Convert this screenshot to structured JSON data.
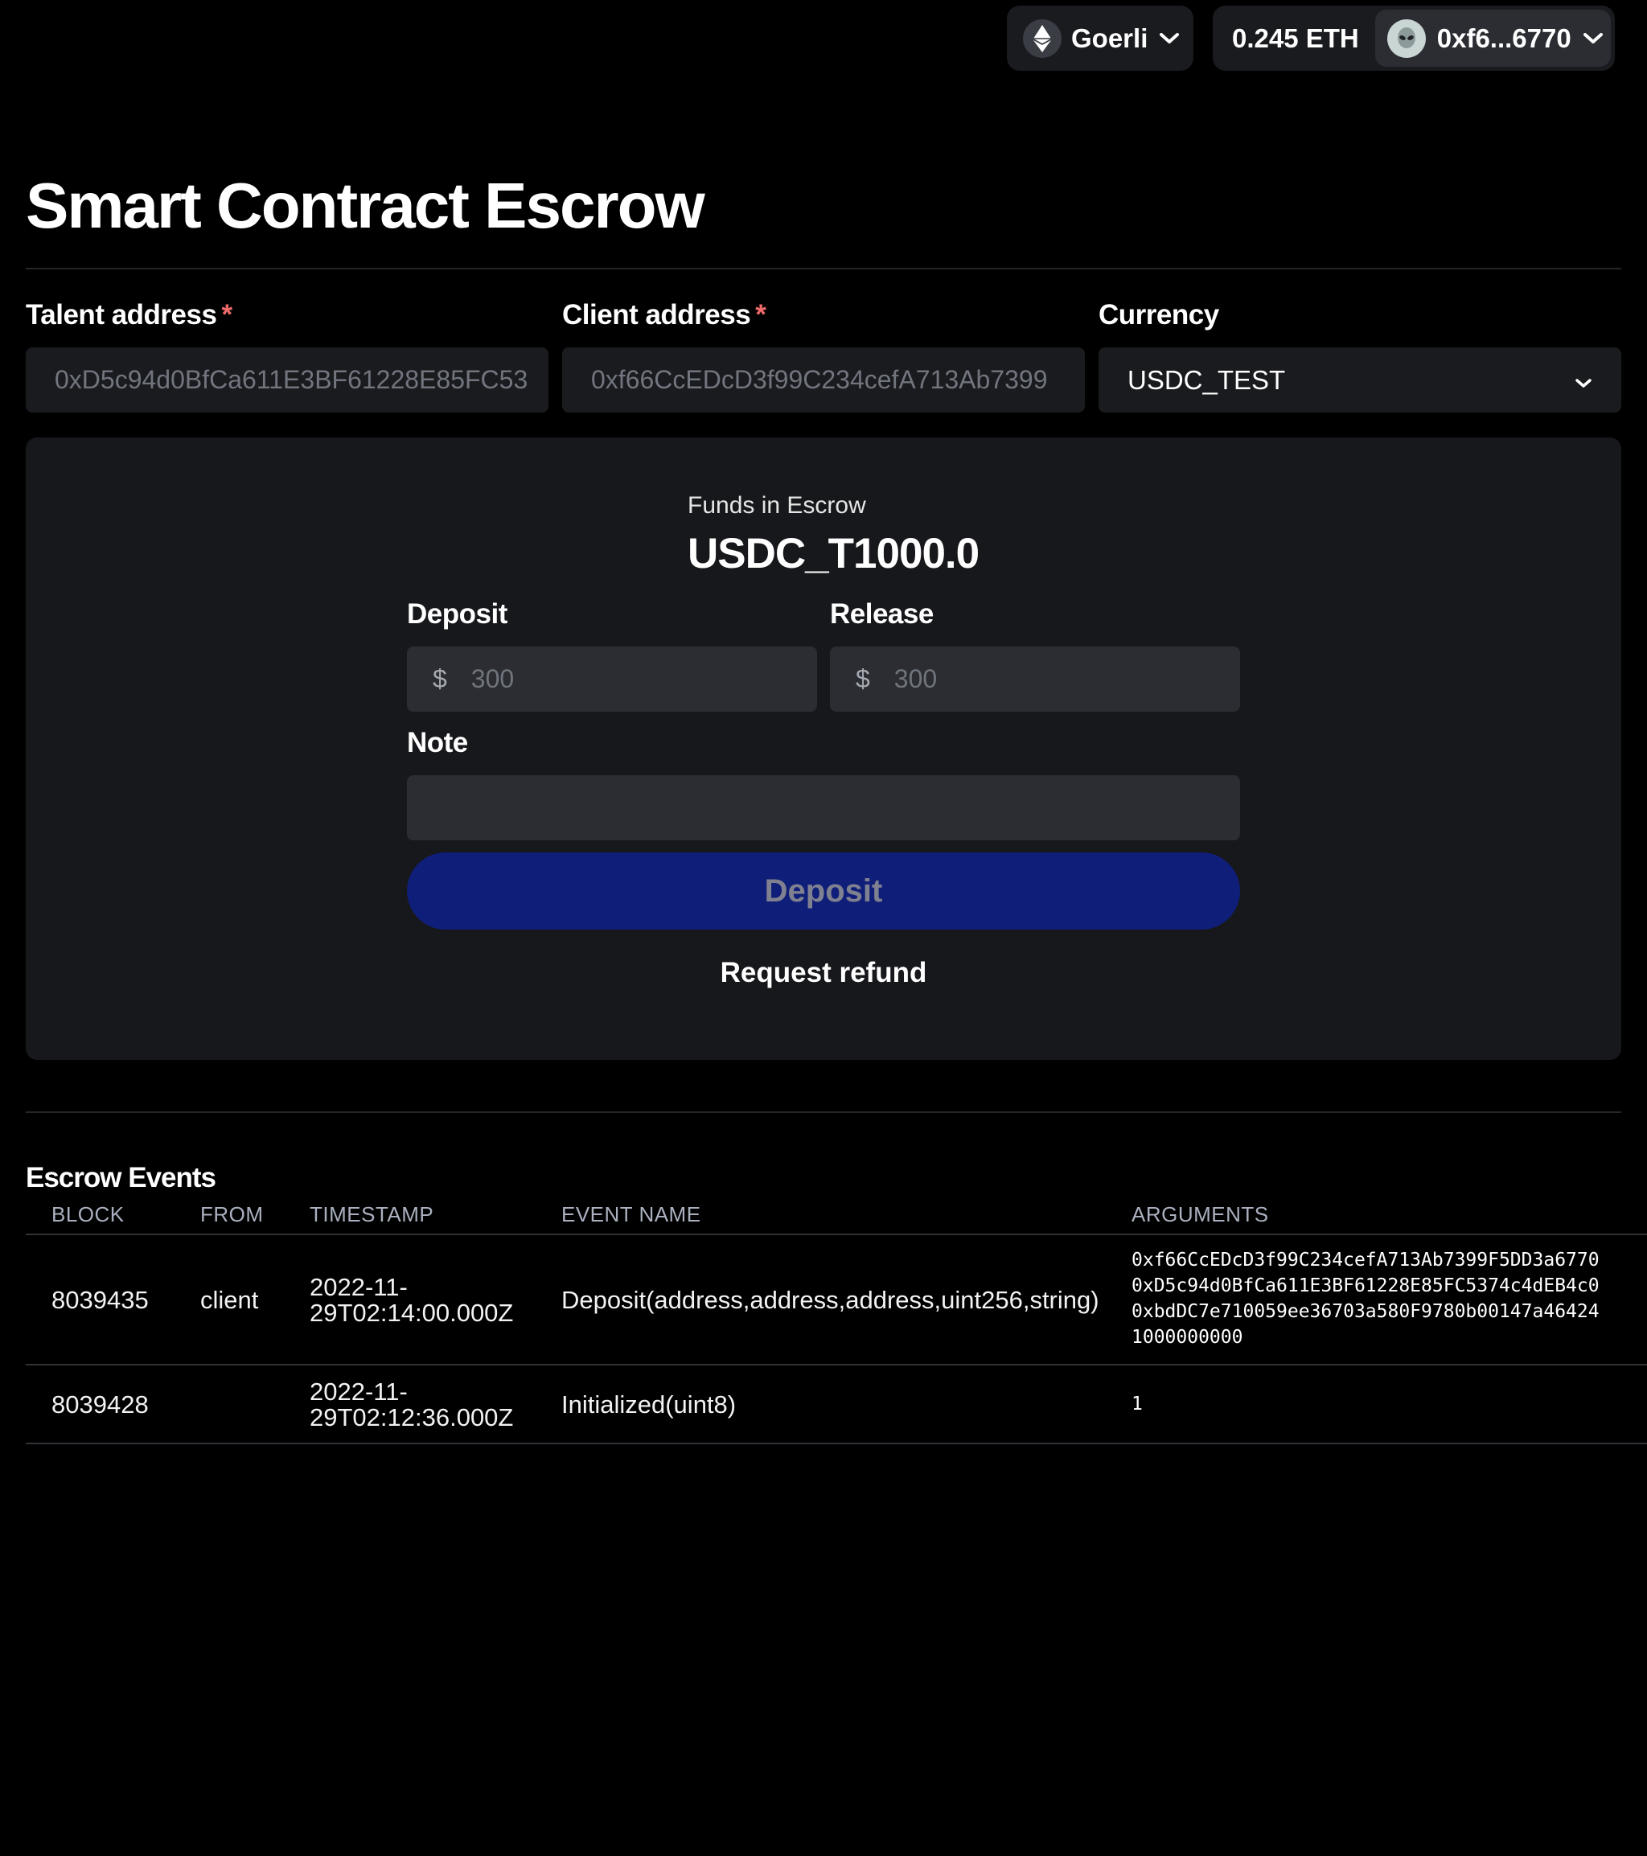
{
  "header": {
    "network": "Goerli",
    "balance": "0.245 ETH",
    "account": "0xf6...6770"
  },
  "page": {
    "title": "Smart Contract Escrow"
  },
  "form": {
    "talent_label": "Talent address",
    "talent_value": "0xD5c94d0BfCa611E3BF61228E85FC53",
    "client_label": "Client address",
    "client_value": "0xf66CcEDcD3f99C234cefA713Ab7399",
    "required_mark": "*",
    "currency_label": "Currency",
    "currency_value": "USDC_TEST"
  },
  "escrow": {
    "funds_label": "Funds in Escrow",
    "funds_value": "USDC_T1000.0",
    "deposit_label": "Deposit",
    "release_label": "Release",
    "currency_symbol": "$",
    "deposit_placeholder": "300",
    "release_placeholder": "300",
    "note_label": "Note",
    "note_value": "",
    "deposit_button": "Deposit",
    "refund_link": "Request refund"
  },
  "events": {
    "title": "Escrow Events",
    "columns": [
      "BLOCK",
      "FROM",
      "TIMESTAMP",
      "EVENT NAME",
      "ARGUMENTS"
    ],
    "rows": [
      {
        "block": "8039435",
        "from": "client",
        "timestamp_line1": "2022-11-",
        "timestamp_line2": "29T02:14:00.000Z",
        "event_name": "Deposit(address,address,address,uint256,string)",
        "arguments": [
          "0xf66CcEDcD3f99C234cefA713Ab7399F5DD3a6770",
          "0xD5c94d0BfCa611E3BF61228E85FC5374c4dEB4c0",
          "0xbdDC7e710059ee36703a580F9780b00147a46424",
          "1000000000"
        ]
      },
      {
        "block": "8039428",
        "from": "",
        "timestamp_line1": "2022-11-",
        "timestamp_line2": "29T02:12:36.000Z",
        "event_name": "Initialized(uint8)",
        "arguments": [
          "1"
        ]
      }
    ]
  },
  "colors": {
    "background": "#000000",
    "panel": "#17181b",
    "input": "#2b2d32",
    "primary_button": "#0f1e78",
    "required": "#f26b6b"
  },
  "icons": {
    "network": "ethereum-icon",
    "account": "alien-avatar-icon",
    "dropdown": "chevron-down-icon"
  }
}
